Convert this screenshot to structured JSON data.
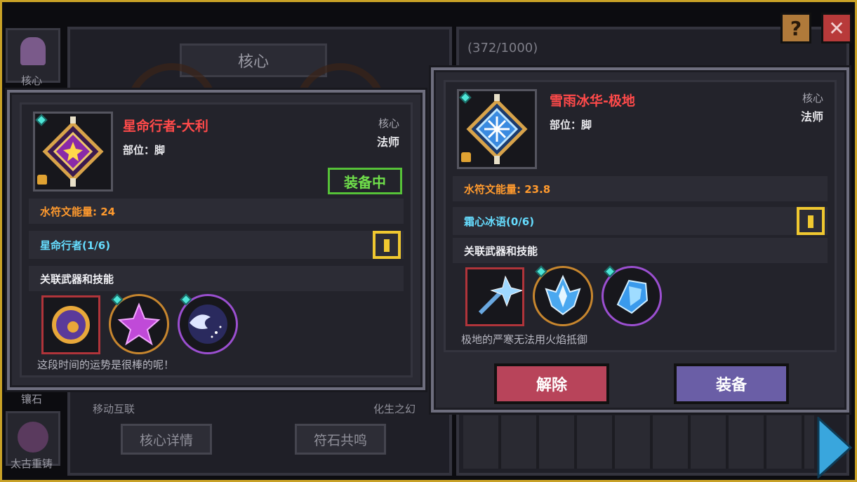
{
  "background": {
    "side_tabs": [
      {
        "label": "核心"
      },
      {
        "label": "镶石"
      },
      {
        "label": "太古重铸"
      }
    ],
    "center_title": "核心",
    "progress": "(372/1000)",
    "bottom_left_label": "移动互联",
    "bottom_right_label": "化生之幻",
    "detail_button": "核心详情",
    "resonance_button": "符石共鸣",
    "help_label": "?",
    "close_label": "✕"
  },
  "card_left": {
    "name": "星命行者-大利",
    "slot": "部位：脚",
    "category": "核心",
    "class": "法师",
    "equipped_badge": "装备中",
    "rune_energy": "水符文能量: 24",
    "set_bonus": "星命行者(1/6)",
    "related_label": "关联武器和技能",
    "description": "这段时间的运势是很棒的呢！",
    "skills": [
      {
        "icon": "golden-orb-weapon-icon",
        "frame": "square",
        "color": "#b0343a"
      },
      {
        "icon": "purple-star-skill-icon",
        "frame": "circle",
        "color": "#c7862e"
      },
      {
        "icon": "night-wave-skill-icon",
        "frame": "circle",
        "color": "#9b4fd0"
      }
    ]
  },
  "card_right": {
    "name": "雪雨冰华-极地",
    "slot": "部位：脚",
    "category": "核心",
    "class": "法师",
    "rune_energy": "水符文能量: 23.8",
    "set_bonus": "霜心冰语(0/6)",
    "related_label": "关联武器和技能",
    "description": "极地的严寒无法用火焰抵御",
    "skills": [
      {
        "icon": "ice-staff-weapon-icon",
        "frame": "square",
        "color": "#b0343a"
      },
      {
        "icon": "ice-crystal-skill-icon",
        "frame": "circle",
        "color": "#c7862e"
      },
      {
        "icon": "frost-shard-skill-icon",
        "frame": "circle",
        "color": "#9b4fd0"
      }
    ],
    "remove_button": "解除",
    "equip_button": "装备"
  },
  "colors": {
    "name_red": "#ff4a4a",
    "energy_orange": "#ff9a2e",
    "set_cyan": "#66ddff",
    "equipped_green": "#6fdf4a",
    "remove_btn": "#b8445a",
    "equip_btn": "#6a5ea6",
    "next_arrow": "#39a6dd"
  }
}
